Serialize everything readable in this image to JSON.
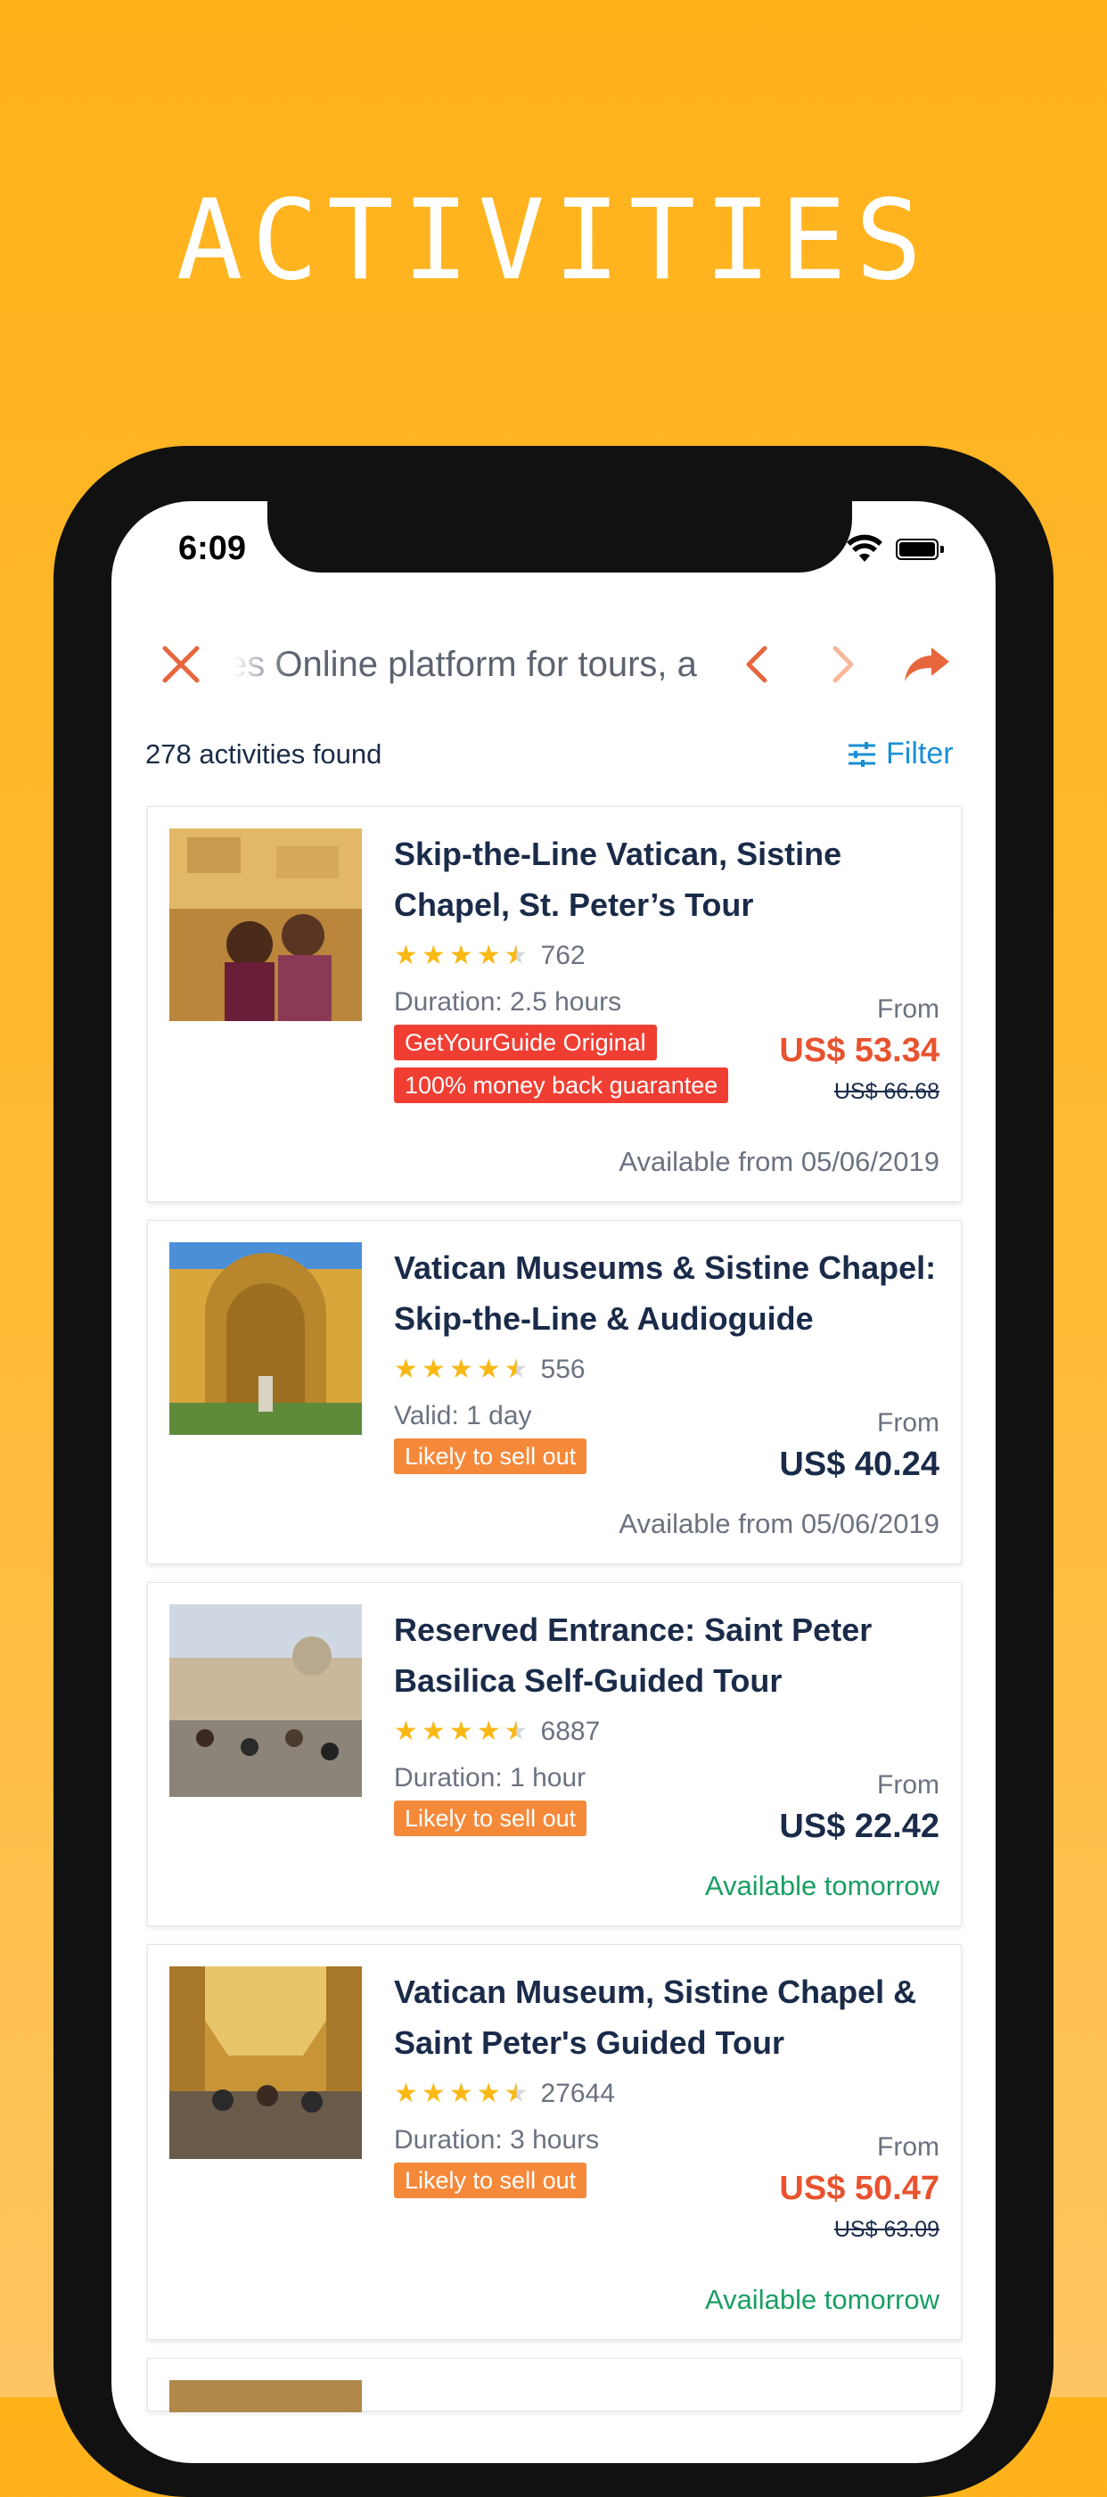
{
  "headline": "ACTIVITIES",
  "status_bar": {
    "time": "6:09"
  },
  "toolbar": {
    "title": "es  Online platform for tours, a",
    "icons": [
      "close-icon",
      "back-icon",
      "forward-icon",
      "share-icon"
    ]
  },
  "results": {
    "count_text": "278 activities found",
    "filter_label": "Filter"
  },
  "activities": [
    {
      "title": "Skip-the-Line Vatican, Sistine Chapel, St. Peter’s Tour",
      "rating": 4.5,
      "reviews": "762",
      "meta": "Duration: 2.5 hours",
      "badges": [
        "GetYourGuide Original",
        "100% money back guarantee"
      ],
      "price_from": "From",
      "price": "US$ 53.34",
      "old_price": "US$ 66.68",
      "availability": "Available from 05/06/2019"
    },
    {
      "title": "Vatican Museums & Sistine Chapel: Skip-the-Line & Audioguide",
      "rating": 4.5,
      "reviews": "556",
      "meta": "Valid: 1 day",
      "badges": [
        "Likely to sell out"
      ],
      "price_from": "From",
      "price": "US$ 40.24",
      "availability": "Available from 05/06/2019"
    },
    {
      "title": "Reserved Entrance: Saint Peter Basilica Self-Guided Tour",
      "rating": 4.5,
      "reviews": "6887",
      "meta": "Duration: 1 hour",
      "badges": [
        "Likely to sell out"
      ],
      "price_from": "From",
      "price": "US$ 22.42",
      "availability": "Available tomorrow"
    },
    {
      "title": "Vatican Museum, Sistine Chapel & Saint Peter's Guided Tour",
      "rating": 4.5,
      "reviews": "27644",
      "meta": "Duration: 3 hours",
      "badges": [
        "Likely to sell out"
      ],
      "price_from": "From",
      "price": "US$ 50.47",
      "old_price": "US$ 63.09",
      "availability": "Available tomorrow"
    }
  ],
  "colors": {
    "background": "#FFB21A",
    "navy": "#1A2B49",
    "price_red": "#E8532F",
    "badge_red": "#F03E33",
    "badge_orange": "#F5893A",
    "available_green": "#1A9E63",
    "filter_blue": "#1A90D6",
    "star": "#F9B814"
  }
}
